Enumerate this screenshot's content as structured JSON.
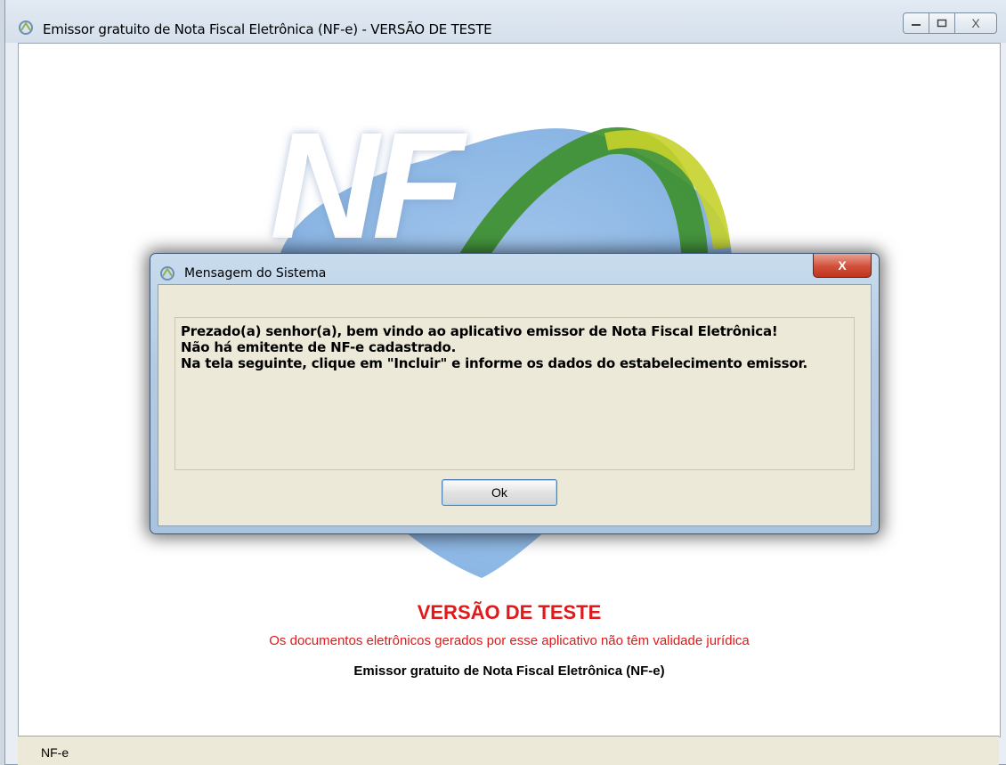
{
  "window": {
    "title": "Emissor gratuito de Nota Fiscal Eletrônica (NF-e) - VERSÃO DE TESTE",
    "icon": "app-icon",
    "controls": [
      "minimize-icon",
      "maximize-icon",
      "close-icon"
    ],
    "close_label": "X"
  },
  "background": {
    "logo_text": "NF",
    "version_title": "VERSÃO DE TESTE",
    "version_subtitle": "Os documentos eletrônicos gerados por esse aplicativo não têm validade jurídica",
    "app_name": "Emissor gratuito de Nota Fiscal Eletrônica (NF-e)"
  },
  "status_bar": {
    "text": "NF-e"
  },
  "dialog": {
    "title": "Mensagem do Sistema",
    "close_label": "X",
    "message_lines": [
      "Prezado(a) senhor(a), bem vindo ao aplicativo emissor de Nota Fiscal Eletrônica!",
      "Não há emitente de NF-e cadastrado.",
      "Na tela seguinte, clique em \"Incluir\" e informe os dados do estabelecimento emissor."
    ],
    "ok_label": "Ok"
  },
  "colors": {
    "accent_red": "#e0191a",
    "dialog_body": "#ece9d8"
  }
}
